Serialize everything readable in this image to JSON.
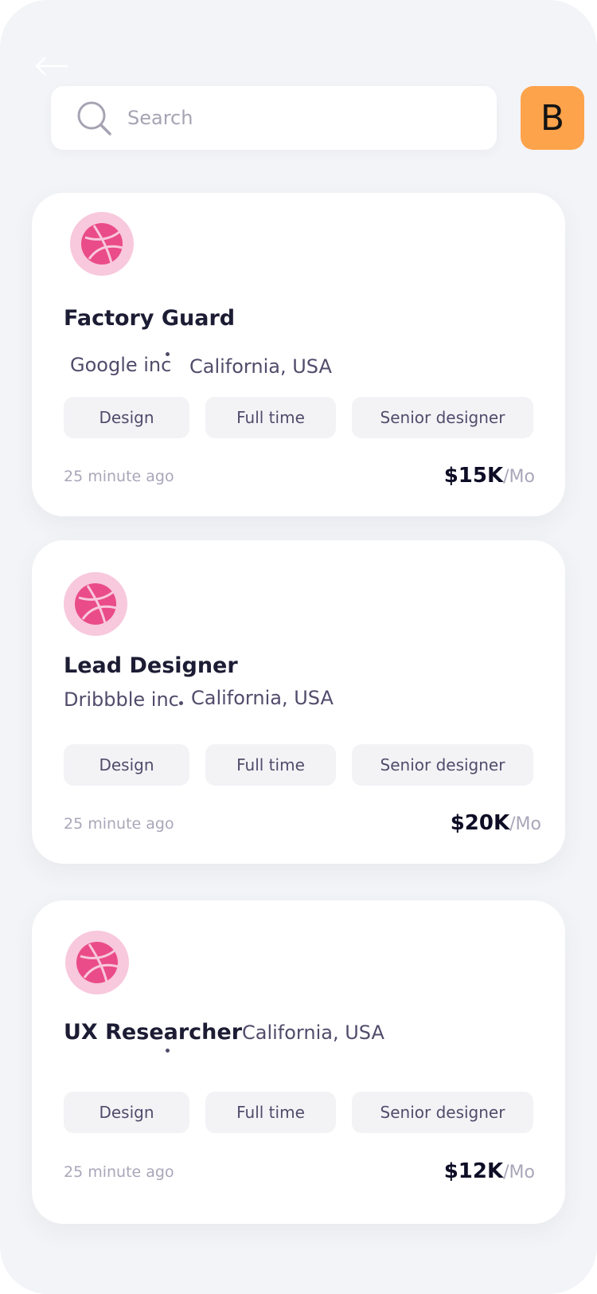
{
  "search": {
    "placeholder": "Search",
    "value": ""
  },
  "avatar": {
    "initial": "B",
    "color": "#fda34b"
  },
  "icons": {
    "back": "back-arrow-icon",
    "search": "search-icon",
    "company_logo": "dribbble-icon"
  },
  "colors": {
    "accent_pink": "#ea4c89",
    "logo_bg": "#f8c8dc",
    "title": "#1c1c34",
    "muted": "#aaa6b9"
  },
  "jobs": [
    {
      "title": "Factory Guard",
      "company": "Google inc",
      "location": "California, USA",
      "tags": [
        "Design",
        "Full time",
        "Senior designer"
      ],
      "posted": "25 minute ago",
      "salary": "$15K",
      "salary_period": "/Mo"
    },
    {
      "title": "Lead Designer",
      "company": "Dribbble inc",
      "location": "California, USA",
      "tags": [
        "Design",
        "Full time",
        "Senior designer"
      ],
      "posted": "25 minute ago",
      "salary": "$20K",
      "salary_period": "/Mo"
    },
    {
      "title": "UX Researcher",
      "location": "California, USA",
      "tags": [
        "Design",
        "Full time",
        "Senior designer"
      ],
      "posted": "25 minute ago",
      "salary": "$12K",
      "salary_period": "/Mo"
    }
  ]
}
